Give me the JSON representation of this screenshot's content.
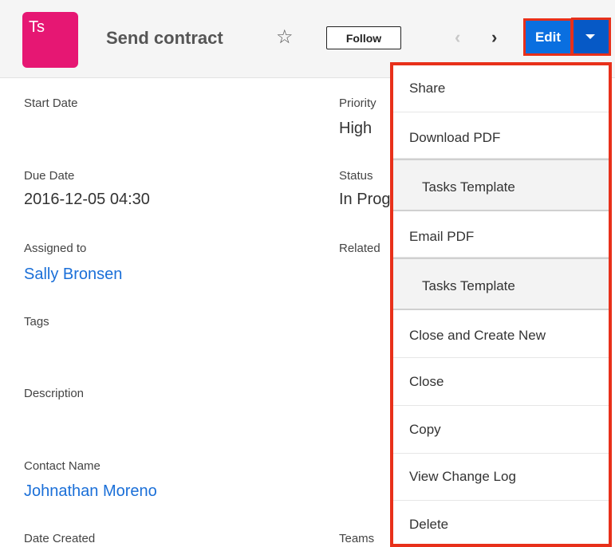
{
  "header": {
    "avatar_initials": "Ts",
    "avatar_color": "#e61773",
    "title": "Send contract",
    "star_glyph": "☆",
    "follow_label": "Follow",
    "prev_glyph": "‹",
    "next_glyph": "›",
    "edit_label": "Edit",
    "accent_color": "#0a6fe0",
    "highlight_color": "#e8301a"
  },
  "fields": {
    "start_date_label": "Start Date",
    "priority_label": "Priority",
    "priority_value": "High",
    "due_date_label": "Due Date",
    "due_date_value": "2016-12-05 04:30",
    "status_label": "Status",
    "status_value": "In Prog",
    "assigned_label": "Assigned to",
    "assigned_value": "Sally Bronsen",
    "related_label": "Related",
    "tags_label": "Tags",
    "description_label": "Description",
    "contact_label": "Contact Name",
    "contact_value": "Johnathan Moreno",
    "date_created_label": "Date Created",
    "teams_label": "Teams"
  },
  "menu": {
    "items": [
      "Share",
      "Download PDF",
      "Tasks Template",
      "Email PDF",
      "Tasks Template",
      "Close and Create New",
      "Close",
      "Copy",
      "View Change Log",
      "Delete"
    ]
  }
}
